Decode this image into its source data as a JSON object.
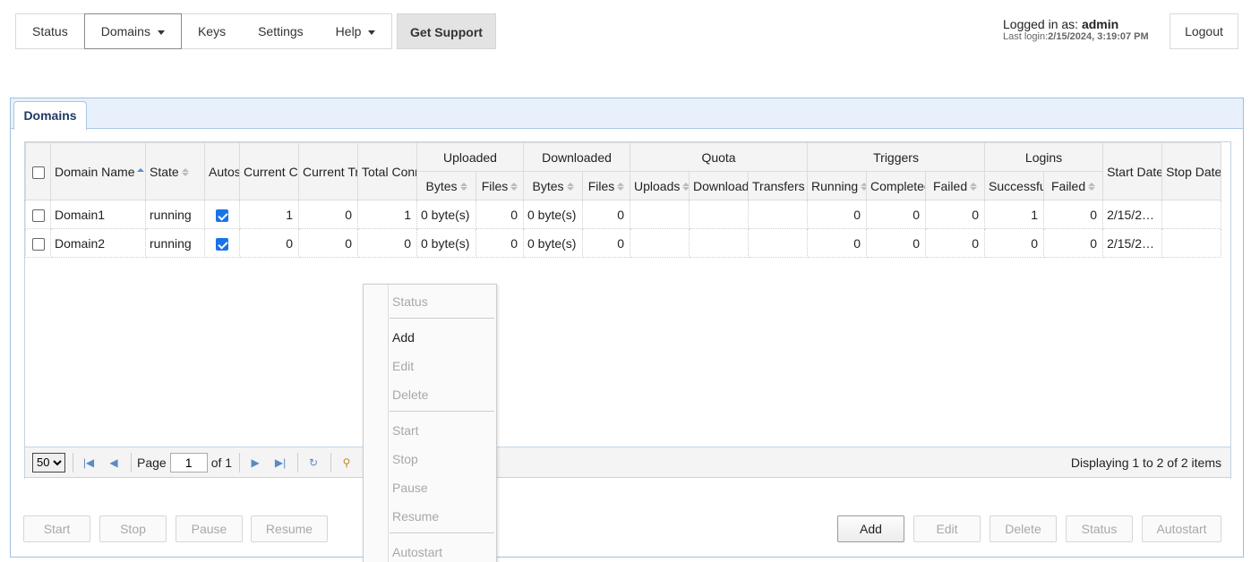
{
  "nav": {
    "items": [
      {
        "label": "Status",
        "dropdown": false,
        "active": false
      },
      {
        "label": "Domains",
        "dropdown": true,
        "active": true
      },
      {
        "label": "Keys",
        "dropdown": false,
        "active": false
      },
      {
        "label": "Settings",
        "dropdown": false,
        "active": false
      },
      {
        "label": "Help",
        "dropdown": true,
        "active": false
      }
    ],
    "get_support": "Get Support"
  },
  "login": {
    "prefix": "Logged in as: ",
    "user": "admin",
    "last_login_prefix": "Last login:",
    "last_login": "2/15/2024, 3:19:07 PM",
    "logout": "Logout"
  },
  "panel": {
    "tab": "Domains"
  },
  "grid": {
    "headers": {
      "domain_name": "Domain Name",
      "state": "State",
      "autostart": "Autostart",
      "current_connections": "Current Connections",
      "current_transfers": "Current Transfers",
      "total_connections": "Total Connections",
      "uploaded": "Uploaded",
      "downloaded": "Downloaded",
      "quota": "Quota",
      "triggers": "Triggers",
      "logins": "Logins",
      "bytes": "Bytes",
      "files": "Files",
      "uploads": "Uploads",
      "downloads": "Downloads",
      "transfers": "Transfers",
      "running": "Running",
      "completed": "Completed",
      "failed": "Failed",
      "successful": "Successful",
      "start_date": "Start Date",
      "stop_date": "Stop Date"
    },
    "rows": [
      {
        "name": "Domain1",
        "state": "running",
        "autostart": true,
        "cur_conn": "1",
        "cur_trans": "0",
        "total_conn": "1",
        "up_bytes": "0 byte(s)",
        "up_files": "0",
        "down_bytes": "0 byte(s)",
        "down_files": "0",
        "q_uploads": "",
        "q_downloads": "",
        "q_transfers": "",
        "t_running": "0",
        "t_completed": "0",
        "t_failed": "0",
        "l_successful": "1",
        "l_failed": "0",
        "start_date": "2/15/2…",
        "stop_date": ""
      },
      {
        "name": "Domain2",
        "state": "running",
        "autostart": true,
        "cur_conn": "0",
        "cur_trans": "0",
        "total_conn": "0",
        "up_bytes": "0 byte(s)",
        "up_files": "0",
        "down_bytes": "0 byte(s)",
        "down_files": "0",
        "q_uploads": "",
        "q_downloads": "",
        "q_transfers": "",
        "t_running": "0",
        "t_completed": "0",
        "t_failed": "0",
        "l_successful": "0",
        "l_failed": "0",
        "start_date": "2/15/2…",
        "stop_date": ""
      }
    ]
  },
  "pager": {
    "page_size": "50",
    "page_label": "Page",
    "page_value": "1",
    "of_label": "of 1",
    "display": "Displaying 1 to 2 of 2 items"
  },
  "buttons": {
    "start": "Start",
    "stop": "Stop",
    "pause": "Pause",
    "resume": "Resume",
    "add": "Add",
    "edit": "Edit",
    "delete": "Delete",
    "status": "Status",
    "autostart": "Autostart"
  },
  "context_menu": {
    "status": "Status",
    "add": "Add",
    "edit": "Edit",
    "delete": "Delete",
    "start": "Start",
    "stop": "Stop",
    "pause": "Pause",
    "resume": "Resume",
    "autostart": "Autostart"
  },
  "colors": {
    "accent": "#1a73e8",
    "running": "#2a7a2a",
    "panel_border": "#9fbfe0"
  }
}
